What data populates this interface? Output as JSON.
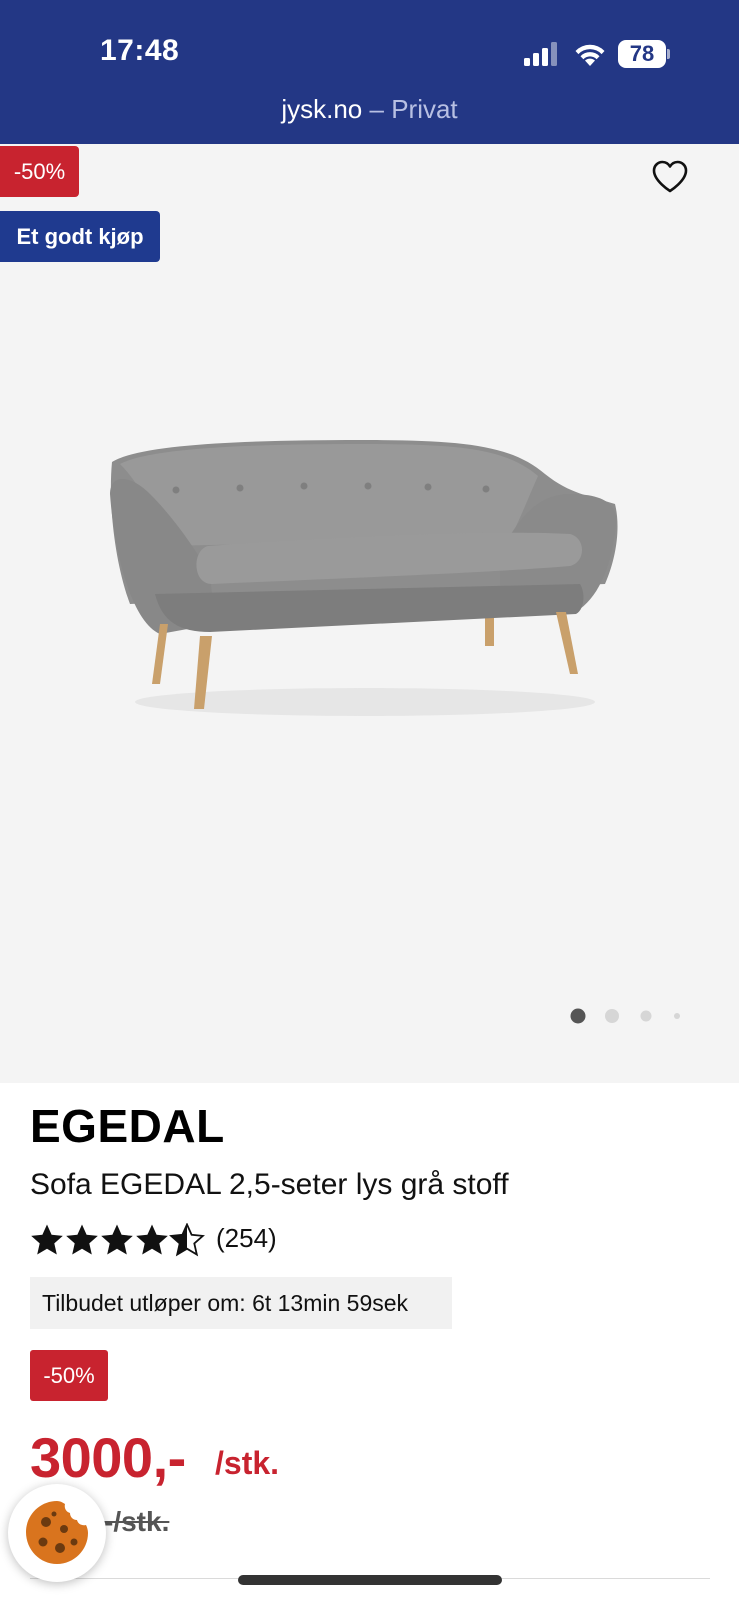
{
  "status_bar": {
    "time": "17:48",
    "battery": "78",
    "url_domain": "jysk.no",
    "url_separator": " – ",
    "url_mode": "Privat",
    "color": "#233785"
  },
  "gallery": {
    "discount_badge": "-50%",
    "deal_badge": "Et godt kjøp",
    "favorite_icon": "heart-outline-icon",
    "image_alt": "sofa",
    "pagination_dots": 4,
    "active_dot": 1
  },
  "product": {
    "brand": "EGEDAL",
    "title": "Sofa EGEDAL 2,5-seter lys grå stoff",
    "rating": 4.5,
    "rating_max": 5,
    "review_count": "(254)",
    "offer_expiry": "Tilbudet utløper om: 6t 13min 59sek",
    "discount_badge": "-50%",
    "price": "3000,-",
    "price_unit": "/stk.",
    "old_price": "-/stk."
  },
  "colors": {
    "brand_blue": "#233785",
    "deal_blue": "#1f3a8f",
    "sale_red": "#c8232f"
  },
  "cookie": {
    "icon": "cookie-icon"
  }
}
